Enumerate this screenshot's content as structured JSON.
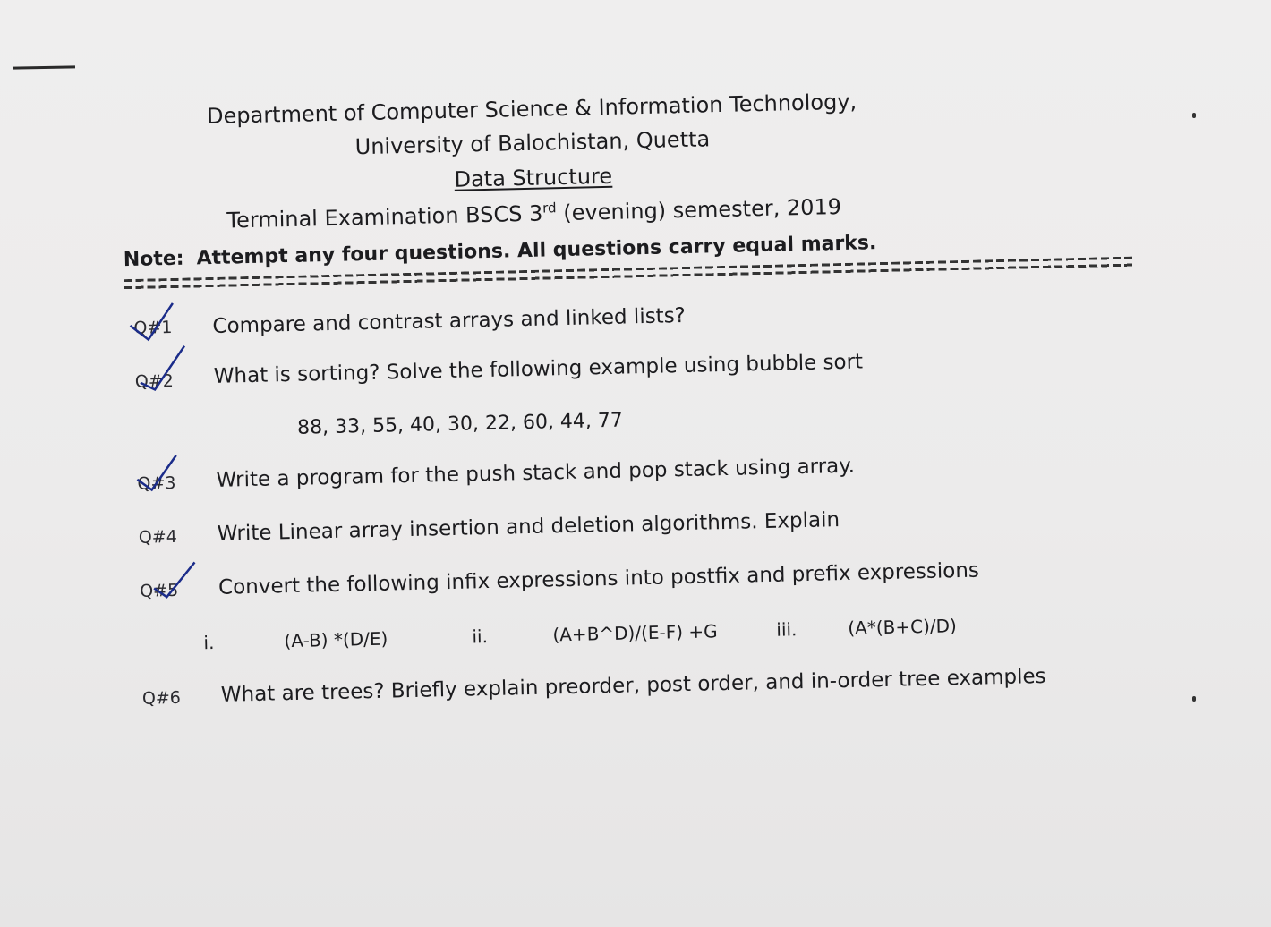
{
  "header": {
    "department": "Department of Computer Science & Information Technology,",
    "university": "University of Balochistan, Quetta",
    "subject": "Data Structure",
    "exam_prefix": "Terminal Examination BSCS 3",
    "exam_sup": "rd",
    "exam_suffix": " (evening) semester, 2019"
  },
  "note": {
    "label": "Note:",
    "text": "Attempt any four questions. All questions carry equal marks."
  },
  "questions": [
    {
      "num": "Q#1",
      "text": "Compare and contrast arrays and linked lists?"
    },
    {
      "num": "Q#2",
      "text": "What is sorting? Solve the following example using bubble sort"
    },
    {
      "num": "Q#3",
      "text": "Write a program for the push stack and pop stack using array."
    },
    {
      "num": "Q#4",
      "text": "Write Linear array insertion and deletion algorithms. Explain"
    },
    {
      "num": "Q#5",
      "text": "Convert the following infix expressions into postfix and prefix expressions"
    },
    {
      "num": "Q#6",
      "text": "What are trees? Briefly explain preorder, post order, and in-order tree examples"
    }
  ],
  "sort_sequence": "88, 33, 55, 40, 30, 22, 60, 44, 77",
  "expressions": [
    {
      "label": "i.",
      "expr": "(A-B) *(D/E)"
    },
    {
      "label": "ii.",
      "expr": "(A+B^D)/(E-F) +G"
    },
    {
      "label": "iii.",
      "expr": "(A*(B+C)/D)"
    }
  ],
  "colors": {
    "ink": "#1c1c1f",
    "pen": "#1b2c8a",
    "paper": "#ecebeb"
  }
}
